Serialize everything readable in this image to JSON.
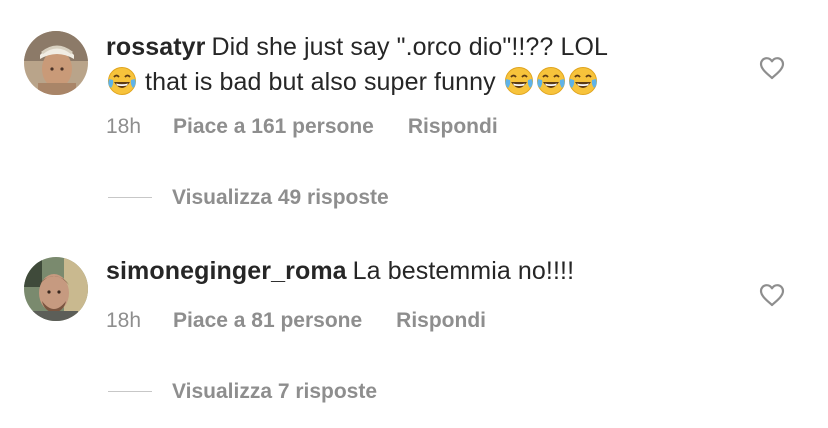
{
  "comments": [
    {
      "username": "rossatyr",
      "text_line1": "Did she just say \".orco dio\"!!?? LOL",
      "text_line2": "that is bad but also super funny",
      "emoji": "face-with-tears-of-joy",
      "time": "18h",
      "likes": "Piace a 161 persone",
      "reply": "Rispondi",
      "view_replies": "Visualizza 49 risposte"
    },
    {
      "username": "simoneginger_roma",
      "text_line1": "La bestemmia no!!!!",
      "time": "18h",
      "likes": "Piace a 81 persone",
      "reply": "Rispondi",
      "view_replies": "Visualizza 7 risposte"
    }
  ],
  "icons": {
    "like": "heart-outline-icon",
    "emoji": "face-with-tears-of-joy"
  },
  "colors": {
    "text": "#262626",
    "muted": "#8e8e8e",
    "background": "#ffffff"
  }
}
